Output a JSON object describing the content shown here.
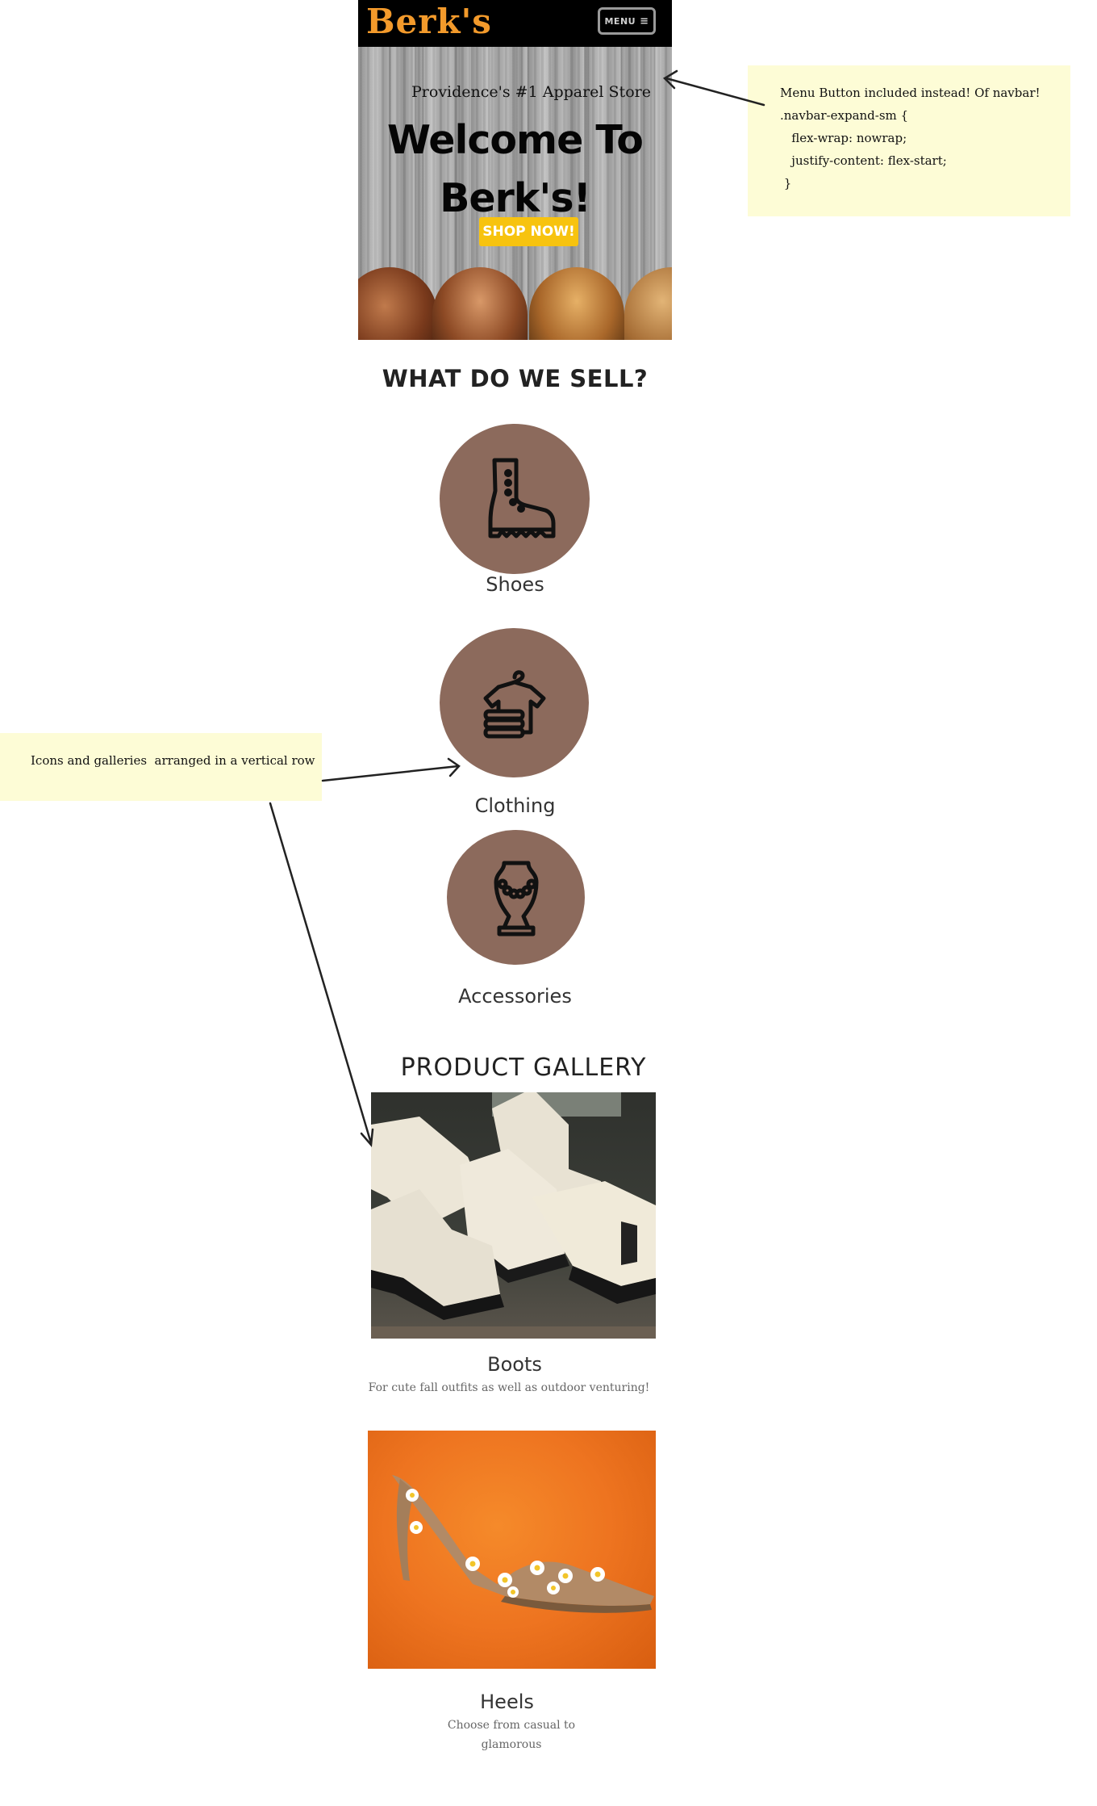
{
  "navbar": {
    "brand": "Berk's",
    "menu_label": "MENU",
    "menu_icon": "hamburger-icon"
  },
  "hero": {
    "tagline": "Providence's #1 Apparel Store",
    "title_line1": "Welcome To",
    "title_line2": "Berk's!",
    "cta_label": "SHOP NOW!"
  },
  "sell": {
    "heading": "WHAT DO WE SELL?",
    "categories": [
      {
        "label": "Shoes",
        "icon": "boot-icon"
      },
      {
        "label": "Clothing",
        "icon": "clothing-icon"
      },
      {
        "label": "Accessories",
        "icon": "necklace-icon"
      }
    ]
  },
  "gallery": {
    "heading": "PRODUCT GALLERY",
    "items": [
      {
        "title": "Boots",
        "description": "For cute fall outfits as well as outdoor venturing!"
      },
      {
        "title": "Heels",
        "description_line1": "Choose from casual to",
        "description_line2": "glamorous"
      }
    ]
  },
  "notes": {
    "menu_note": {
      "lines": [
        "Menu Button included instead! Of navbar!",
        ".navbar-expand-sm {",
        "   flex-wrap: nowrap;",
        "   justify-content: flex-start;",
        " }"
      ]
    },
    "layout_note": {
      "text": "Icons and galleries  arranged in a vertical row"
    }
  },
  "colors": {
    "brand_orange": "#f39a2b",
    "cta_yellow": "#f7c30f",
    "icon_circle": "#8c6a5c",
    "note_background": "#fdfcd6"
  }
}
